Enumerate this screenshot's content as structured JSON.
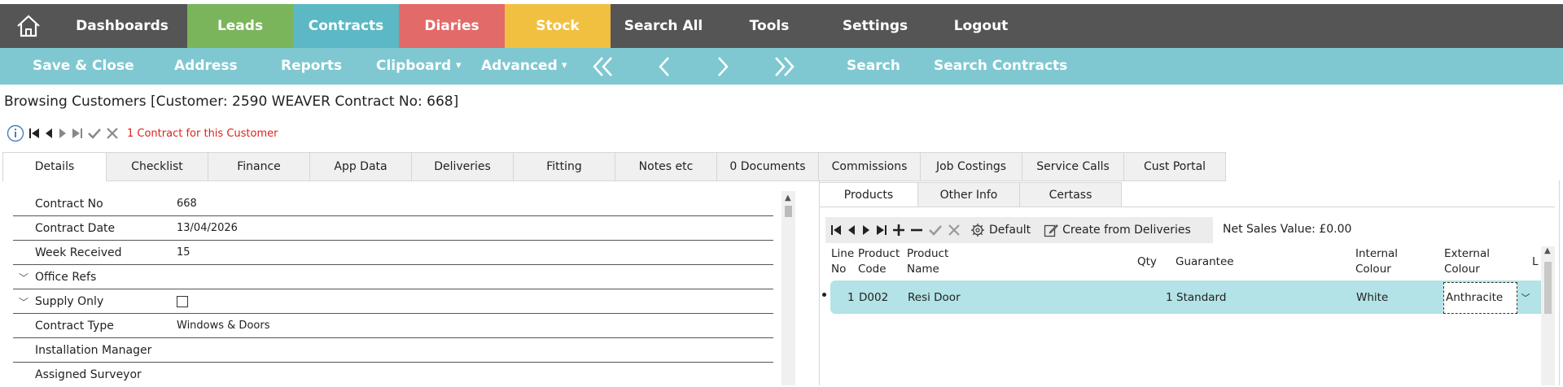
{
  "topnav": {
    "items": [
      {
        "label": "Dashboards",
        "color": "#555555"
      },
      {
        "label": "Leads",
        "color": "#7ab55c"
      },
      {
        "label": "Contracts",
        "color": "#5cb8c4"
      },
      {
        "label": "Diaries",
        "color": "#e26a68"
      },
      {
        "label": "Stock",
        "color": "#f2c040"
      },
      {
        "label": "Search All",
        "color": "#555555"
      },
      {
        "label": "Tools",
        "color": "#555555"
      },
      {
        "label": "Settings",
        "color": "#555555"
      },
      {
        "label": "Logout",
        "color": "#555555"
      }
    ]
  },
  "toolbar": {
    "save_close": "Save & Close",
    "address": "Address",
    "reports": "Reports",
    "clipboard": "Clipboard",
    "advanced": "Advanced",
    "search": "Search",
    "search_contracts": "Search Contracts"
  },
  "browse_title": "Browsing Customers [Customer: 2590 WEAVER Contract No: 668]",
  "record_message": "1 Contract for this Customer",
  "tabs": [
    "Details",
    "Checklist",
    "Finance",
    "App Data",
    "Deliveries",
    "Fitting",
    "Notes etc",
    "0 Documents",
    "Commissions",
    "Job Costings",
    "Service Calls",
    "Cust Portal"
  ],
  "details": {
    "contract_no": {
      "label": "Contract No",
      "value": "668"
    },
    "contract_date": {
      "label": "Contract Date",
      "value": "13/04/2026"
    },
    "week_received": {
      "label": "Week Received",
      "value": "15"
    },
    "office_refs": {
      "label": "Office Refs"
    },
    "supply_only": {
      "label": "Supply Only"
    },
    "contract_type": {
      "label": "Contract Type",
      "value": "Windows & Doors"
    },
    "installation_manager": {
      "label": "Installation Manager"
    },
    "assigned_surveyor": {
      "label": "Assigned Surveyor"
    }
  },
  "right_tabs": [
    "Products",
    "Other Info",
    "Certass"
  ],
  "products_toolbar": {
    "default": "Default",
    "create_from_deliveries": "Create from Deliveries",
    "net_sales_value": "Net Sales Value: £0.00"
  },
  "grid": {
    "headers": {
      "line_no": [
        "Line",
        "No"
      ],
      "product_code": [
        "Product",
        "Code"
      ],
      "product_name": [
        "Product",
        "Name"
      ],
      "qty": "Qty",
      "guarantee": "Guarantee",
      "internal_colour": [
        "Internal",
        "Colour"
      ],
      "external_colour": [
        "External",
        "Colour"
      ],
      "more": "L"
    },
    "row": {
      "line_no": "1",
      "product_code": "D002",
      "product_name": "Resi Door",
      "qty": "1",
      "guarantee": "Standard",
      "internal_colour": "White",
      "external_colour": "Anthracite"
    }
  }
}
